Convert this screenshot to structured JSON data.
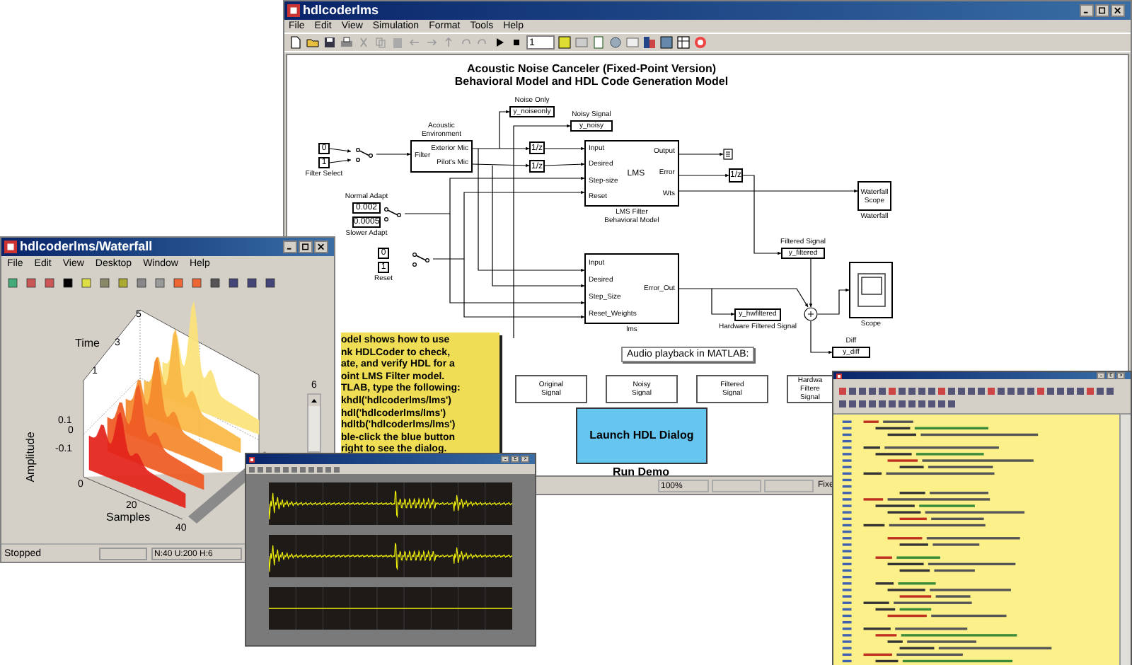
{
  "main_window": {
    "title": "hdlcoderlms",
    "menu": [
      "File",
      "Edit",
      "View",
      "Simulation",
      "Format",
      "Tools",
      "Help"
    ],
    "stop_time": "1",
    "diagram": {
      "title": [
        "Acoustic Noise Canceler (Fixed-Point Version)",
        "Behavioral Model and HDL Code Generation Model"
      ],
      "blocks": [
        {
          "kind": "constant",
          "text": "0"
        },
        {
          "kind": "constant",
          "text": "1",
          "label": "Filter Select"
        },
        {
          "kind": "switch"
        },
        {
          "kind": "subsystem",
          "label": "Acoustic\nEnvironment",
          "inputs": [
            "Filter"
          ],
          "outputs": [
            "Exterior Mic",
            "Pilot's Mic"
          ]
        },
        {
          "kind": "to_workspace",
          "text": "y_noiseonly",
          "label": "Noise Only"
        },
        {
          "kind": "to_workspace",
          "text": "y_noisy",
          "label": "Noisy Signal"
        },
        {
          "kind": "unit_delay",
          "text": "1/z"
        },
        {
          "kind": "unit_delay",
          "text": "1/z"
        },
        {
          "kind": "subsystem",
          "text": "LMS",
          "label": "LMS Filter\nBehavioral Model",
          "inputs": [
            "Input",
            "Desired",
            "Step-size",
            "Reset"
          ],
          "outputs": [
            "Output",
            "Error",
            "Wts"
          ]
        },
        {
          "kind": "terminator"
        },
        {
          "kind": "unit_delay",
          "text": "1/z"
        },
        {
          "kind": "constant",
          "text": "0.002",
          "label": "Normal Adapt"
        },
        {
          "kind": "constant",
          "text": "0.0005",
          "label": "Slower Adapt"
        },
        {
          "kind": "switch"
        },
        {
          "kind": "scope",
          "text": "Waterfall\nScope",
          "label": "Waterfall"
        },
        {
          "kind": "constant",
          "text": "0"
        },
        {
          "kind": "constant",
          "text": "1",
          "label": "Reset"
        },
        {
          "kind": "switch"
        },
        {
          "kind": "to_workspace",
          "text": "y_filtered",
          "label": "Filtered Signal"
        },
        {
          "kind": "subsystem",
          "label": "lms",
          "inputs": [
            "Input",
            "Desired",
            "Step_Size",
            "Reset_Weights"
          ],
          "outputs": [
            "Error_Out"
          ]
        },
        {
          "kind": "to_workspace",
          "text": "y_hwfiltered",
          "label": "Hardware Filtered Signal"
        },
        {
          "kind": "sum"
        },
        {
          "kind": "scope",
          "label": "Scope"
        },
        {
          "kind": "to_workspace",
          "text": "y_diff",
          "label": "Diff"
        }
      ],
      "note": [
        "odel shows how to use",
        "nk HDLCoder to check,",
        "ate, and verify HDL for a",
        "oint LMS Filter model.",
        "TLAB, type the following:",
        "khdl('hdlcoderlms/lms')",
        "hdl('hdlcoderlms/lms')",
        "hdltb('hdlcoderlms/lms')",
        "ble-click the blue button",
        "right to see the dialog."
      ],
      "audio_label": "Audio playback in MATLAB:",
      "audio_buttons": [
        "Original\nSignal",
        "Noisy\nSignal",
        "Filtered\nSignal",
        "Hardwa\nFiltere\nSignal"
      ],
      "launch_button": "Launch HDL Dialog",
      "launch_caption": "Run Demo"
    },
    "status_bar": [
      "100%",
      "Fixe"
    ]
  },
  "waterfall_window": {
    "title": "hdlcoderlms/Waterfall",
    "menu": [
      "File",
      "Edit",
      "View",
      "Desktop",
      "Window",
      "Help"
    ],
    "plot": {
      "zlabel": "Time",
      "ylabel": "Amplitude",
      "xlabel": "Samples",
      "time_ticks": [
        "1",
        "3",
        "5"
      ],
      "amplitude_ticks": [
        "0.1",
        "0",
        "-0.1"
      ],
      "sample_ticks": [
        "0",
        "20",
        "40"
      ]
    },
    "slider_value": "6",
    "status": "Stopped",
    "info": "N:40 U:200 H:6"
  }
}
